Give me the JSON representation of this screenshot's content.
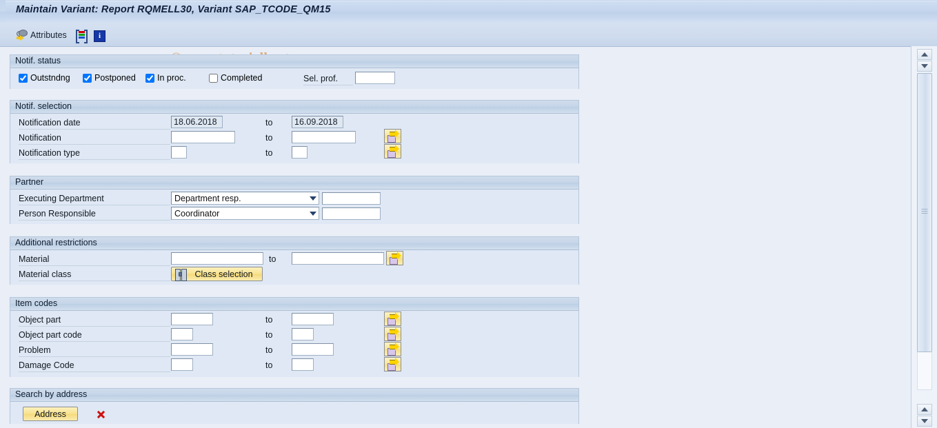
{
  "window": {
    "title": "Maintain Variant: Report RQMELL30, Variant SAP_TCODE_QM15"
  },
  "toolbar": {
    "attributes_label": "Attributes",
    "attributes_icon": "attributes-icon",
    "bars_icon": "colored-bars-icon",
    "info_icon": "info-icon"
  },
  "watermark": "© www.tutorialkart.com",
  "sections": {
    "notif_status": {
      "title": "Notif. status",
      "checkboxes": [
        {
          "label": "Outstndng",
          "checked": true
        },
        {
          "label": "Postponed",
          "checked": true
        },
        {
          "label": "In proc.",
          "checked": true
        },
        {
          "label": "Completed",
          "checked": false
        }
      ],
      "sel_prof_label": "Sel. prof.",
      "sel_prof_value": ""
    },
    "notif_selection": {
      "title": "Notif. selection",
      "to_label": "to",
      "rows": [
        {
          "label": "Notification date",
          "from": "18.06.2018",
          "to": "16.09.2018"
        },
        {
          "label": "Notification",
          "from": "",
          "to": ""
        },
        {
          "label": "Notification type",
          "from": "",
          "to": ""
        }
      ]
    },
    "partner": {
      "title": "Partner",
      "rows": [
        {
          "label": "Executing Department",
          "selected": "Department resp.",
          "value": ""
        },
        {
          "label": "Person Responsible",
          "selected": "Coordinator",
          "value": ""
        }
      ]
    },
    "additional_restrictions": {
      "title": "Additional restrictions",
      "to_label": "to",
      "material_label": "Material",
      "material_from": "",
      "material_to": "",
      "material_class_label": "Material class",
      "class_selection_label": "Class selection"
    },
    "item_codes": {
      "title": "Item codes",
      "to_label": "to",
      "rows": [
        {
          "label": "Object part",
          "from": "",
          "to": ""
        },
        {
          "label": "Object part code",
          "from": "",
          "to": ""
        },
        {
          "label": "Problem",
          "from": "",
          "to": ""
        },
        {
          "label": "Damage Code",
          "from": "",
          "to": ""
        }
      ]
    },
    "search_by_address": {
      "title": "Search by address",
      "address_button_label": "Address",
      "delete_icon": "delete-x-icon"
    }
  },
  "colors": {
    "page_background": "#e9eef7",
    "panel_background": "#dfe8f4",
    "section_header": "#c5d5e8",
    "title_bar": "#c9daef",
    "button_yellow": "#f8e391",
    "watermark": "#e0ab7c",
    "accent_arrow": "#ffd400"
  }
}
